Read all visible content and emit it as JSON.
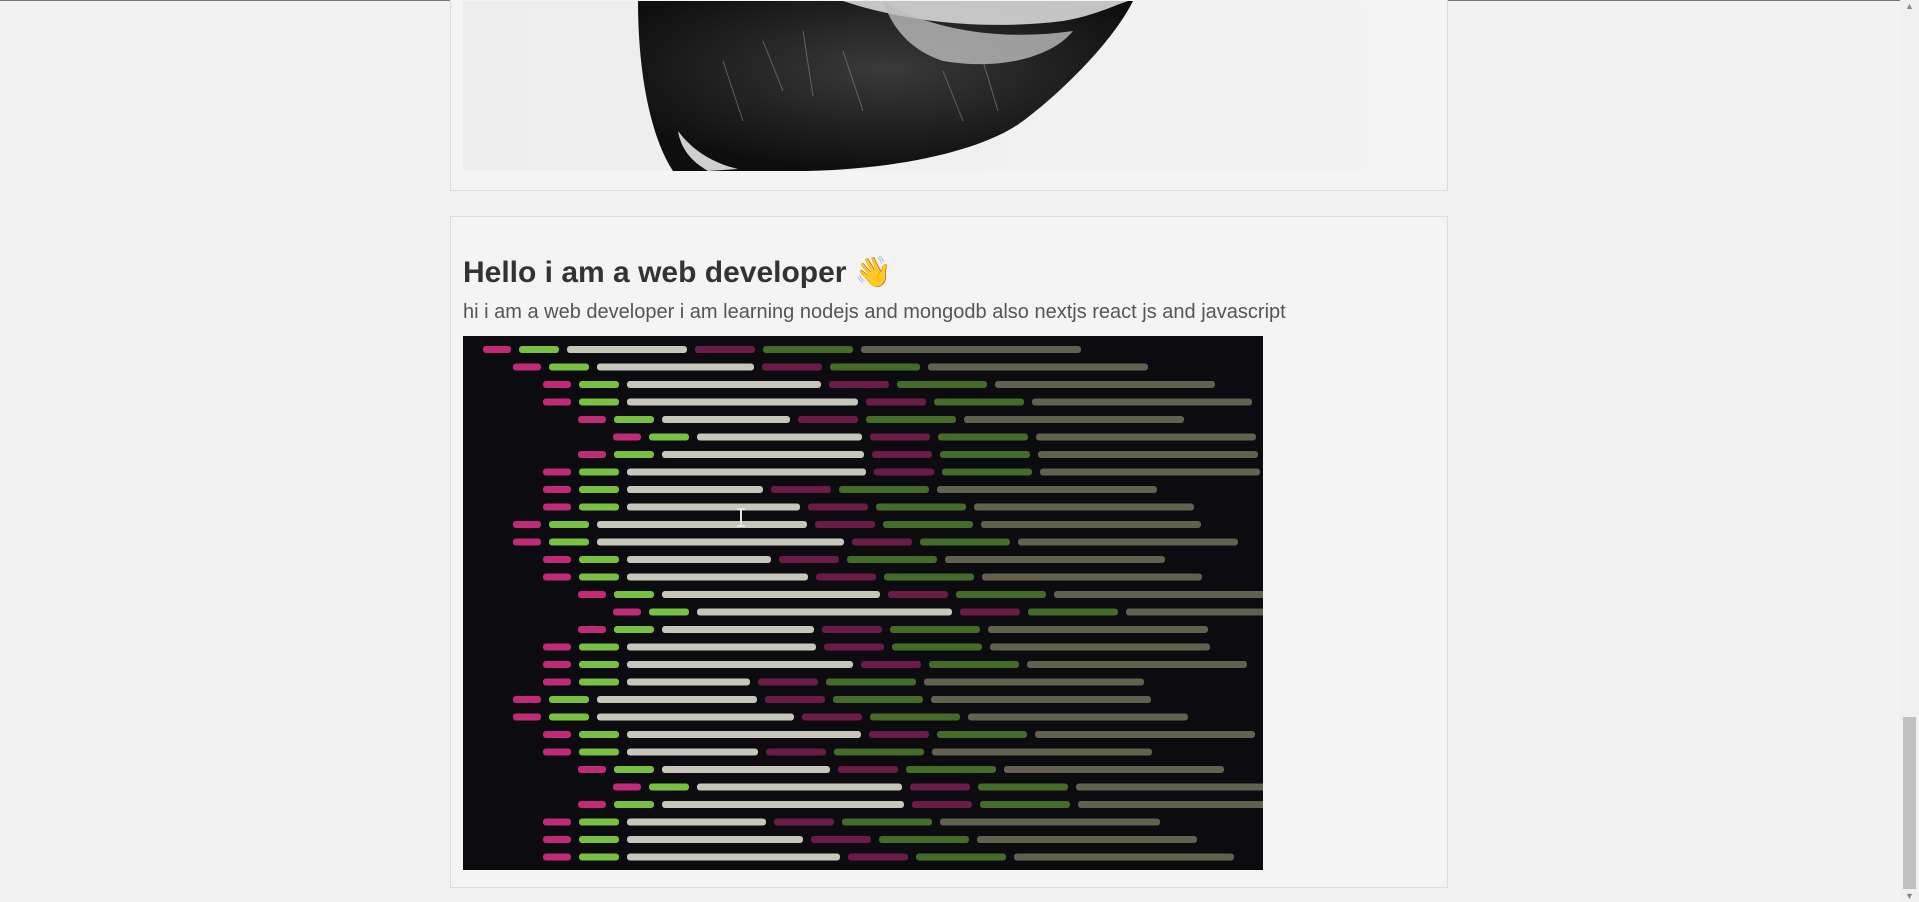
{
  "post": {
    "title": "Hello i am a web developer",
    "emoji": "👋",
    "text": "hi i am a web developer i am learning nodejs and mongodb also nextjs react js and javascript"
  },
  "icons": {
    "scroll_up": "scroll-up-arrow-icon",
    "scroll_down": "scroll-down-arrow-icon",
    "text_cursor": "text-cursor-icon"
  },
  "colors": {
    "page_bg": "#f2f2f2",
    "card_border": "#dcdcdc",
    "title_text": "#333333",
    "body_text": "#555555"
  }
}
